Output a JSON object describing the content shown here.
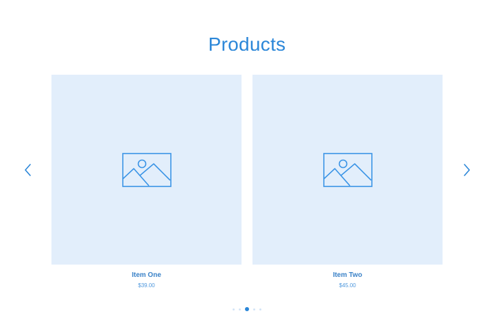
{
  "section": {
    "title": "Products"
  },
  "products": [
    {
      "name": "Item One",
      "price": "$39.00",
      "image_icon": "image-placeholder-icon"
    },
    {
      "name": "Item Two",
      "price": "$45.00",
      "image_icon": "image-placeholder-icon"
    }
  ],
  "navigation": {
    "prev_icon": "chevron-left-icon",
    "next_icon": "chevron-right-icon"
  },
  "pagination": {
    "total": 5,
    "active_index": 2
  },
  "colors": {
    "accent": "#2a86d8",
    "image_background": "#e2eefb",
    "dot_inactive": "#d2e4f6"
  }
}
